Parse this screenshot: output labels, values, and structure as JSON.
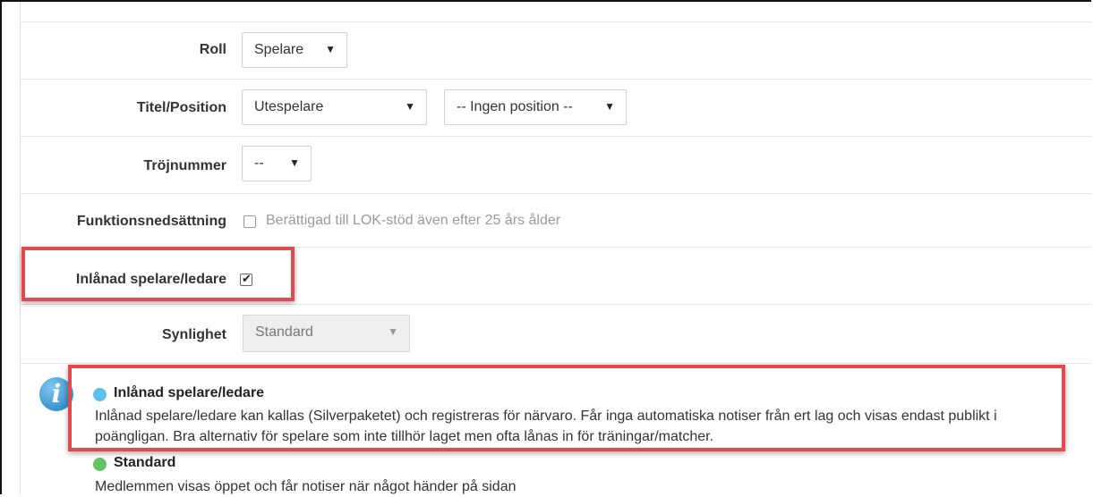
{
  "form": {
    "roll": {
      "label": "Roll",
      "value": "Spelare"
    },
    "titel": {
      "label": "Titel/Position",
      "value": "Utespelare",
      "position_value": "-- Ingen position --"
    },
    "trojnummer": {
      "label": "Tröjnummer",
      "value": "--"
    },
    "funktion": {
      "label": "Funktionsnedsättning",
      "checkbox_text": "Berättigad till LOK-stöd även efter 25 års ålder",
      "checked": false
    },
    "inlanad": {
      "label": "Inlånad spelare/ledare",
      "checked": true
    },
    "synlighet": {
      "label": "Synlighet",
      "value": "Standard",
      "disabled": true
    }
  },
  "info": {
    "icon": "info-icon",
    "options": [
      {
        "title": "Inlånad spelare/ledare",
        "color": "#5bc0eb",
        "description": "Inlånad spelare/ledare kan kallas (Silverpaketet) och registreras för närvaro. Får inga automatiska notiser från ert lag och visas endast publikt i poängligan. Bra alternativ för spelare som inte tillhör laget men ofta lånas in för träningar/matcher."
      },
      {
        "title": "Standard",
        "color": "#62c462",
        "description": "Medlemmen visas öppet och får notiser när något händer på sidan"
      }
    ]
  },
  "colors": {
    "highlight": "#e5484d",
    "arrow_glyph": "▼",
    "check_glyph": "✔"
  }
}
